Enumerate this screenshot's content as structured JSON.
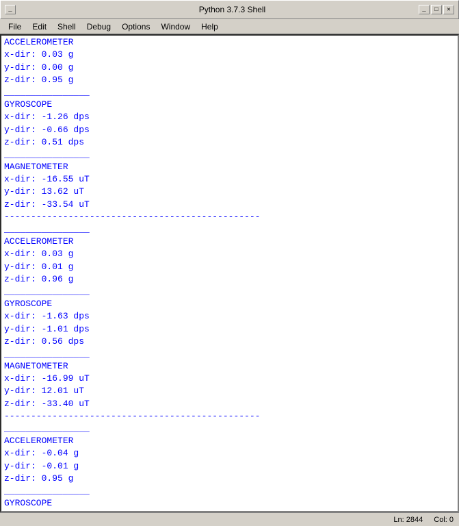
{
  "titleBar": {
    "title": "Python 3.7.3 Shell",
    "minimizeLabel": "_",
    "maximizeLabel": "□",
    "closeLabel": "✕"
  },
  "menuBar": {
    "items": [
      "File",
      "Edit",
      "Shell",
      "Debug",
      "Options",
      "Window",
      "Help"
    ]
  },
  "statusBar": {
    "line": "Ln: 2844",
    "col": "Col: 0"
  },
  "shellLines": [
    {
      "type": "separator",
      "text": "------------------------------------------------"
    },
    {
      "type": "blank",
      "text": ""
    },
    {
      "type": "data",
      "text": "ACCELEROMETER"
    },
    {
      "type": "data",
      "text": "x-dir: 0.03 g"
    },
    {
      "type": "data",
      "text": "y-dir: 0.00 g"
    },
    {
      "type": "data",
      "text": "z-dir: 0.95 g"
    },
    {
      "type": "divider",
      "text": "________________"
    },
    {
      "type": "blank",
      "text": ""
    },
    {
      "type": "data",
      "text": "GYROSCOPE"
    },
    {
      "type": "data",
      "text": "x-dir: -1.26 dps"
    },
    {
      "type": "data",
      "text": "y-dir: -0.66 dps"
    },
    {
      "type": "data",
      "text": "z-dir: 0.51 dps"
    },
    {
      "type": "divider",
      "text": "________________"
    },
    {
      "type": "blank",
      "text": ""
    },
    {
      "type": "data",
      "text": "MAGNETOMETER"
    },
    {
      "type": "data",
      "text": "x-dir: -16.55 uT"
    },
    {
      "type": "data",
      "text": "y-dir: 13.62 uT"
    },
    {
      "type": "data",
      "text": "z-dir: -33.54 uT"
    },
    {
      "type": "separator",
      "text": "------------------------------------------------"
    },
    {
      "type": "divider",
      "text": "________________"
    },
    {
      "type": "blank",
      "text": ""
    },
    {
      "type": "data",
      "text": "ACCELEROMETER"
    },
    {
      "type": "data",
      "text": "x-dir: 0.03 g"
    },
    {
      "type": "data",
      "text": "y-dir: 0.01 g"
    },
    {
      "type": "data",
      "text": "z-dir: 0.96 g"
    },
    {
      "type": "divider",
      "text": "________________"
    },
    {
      "type": "blank",
      "text": ""
    },
    {
      "type": "data",
      "text": "GYROSCOPE"
    },
    {
      "type": "data",
      "text": "x-dir: -1.63 dps"
    },
    {
      "type": "data",
      "text": "y-dir: -1.01 dps"
    },
    {
      "type": "data",
      "text": "z-dir: 0.56 dps"
    },
    {
      "type": "divider",
      "text": "________________"
    },
    {
      "type": "blank",
      "text": ""
    },
    {
      "type": "data",
      "text": "MAGNETOMETER"
    },
    {
      "type": "data",
      "text": "x-dir: -16.99 uT"
    },
    {
      "type": "data",
      "text": "y-dir: 12.01 uT"
    },
    {
      "type": "data",
      "text": "z-dir: -33.40 uT"
    },
    {
      "type": "separator",
      "text": "------------------------------------------------"
    },
    {
      "type": "divider",
      "text": "________________"
    },
    {
      "type": "blank",
      "text": ""
    },
    {
      "type": "data",
      "text": "ACCELEROMETER"
    },
    {
      "type": "data",
      "text": "x-dir: -0.04 g"
    },
    {
      "type": "data",
      "text": "y-dir: -0.01 g"
    },
    {
      "type": "data",
      "text": "z-dir: 0.95 g"
    },
    {
      "type": "divider",
      "text": "________________"
    },
    {
      "type": "blank",
      "text": ""
    },
    {
      "type": "data",
      "text": "GYROSCOPE"
    }
  ]
}
